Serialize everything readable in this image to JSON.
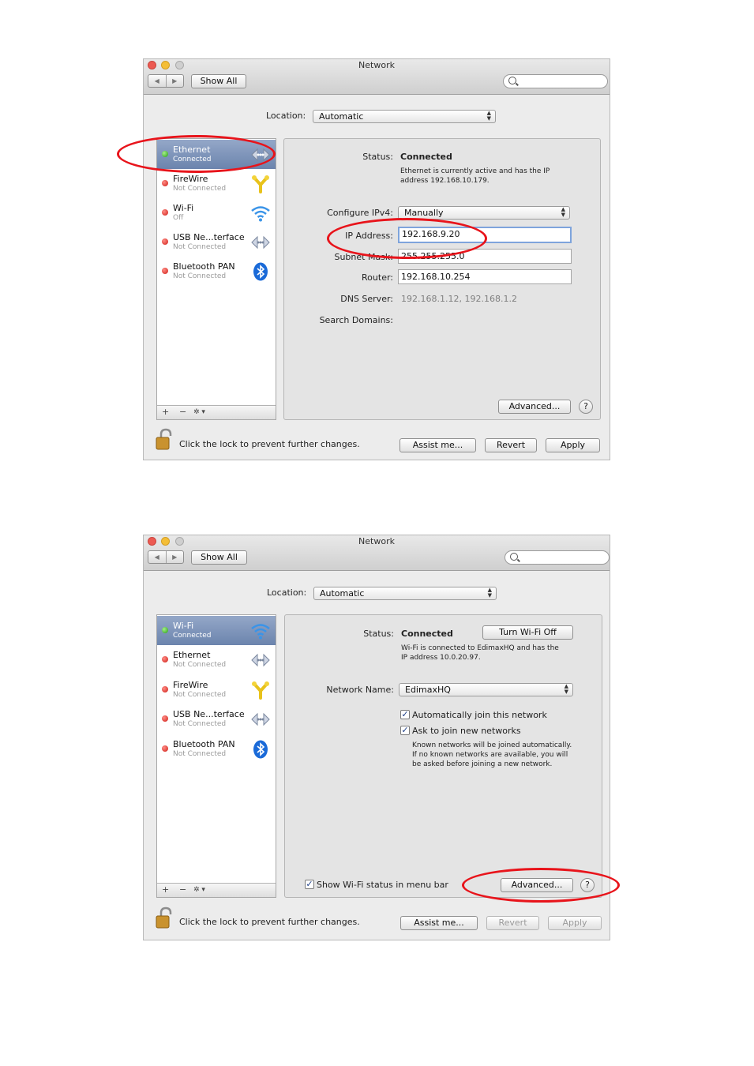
{
  "colors": {
    "annotation_red": "#e8141b",
    "selected_row": "#7f95bb",
    "status_red": "#d8241d",
    "status_green": "#35b01d"
  },
  "icons": {
    "ethernet": "ethernet-arrows-icon",
    "firewire": "firewire-icon",
    "wifi": "wifi-signal-icon",
    "usb": "usb-arrows-icon",
    "bluetooth": "bluetooth-icon",
    "lock": "padlock-icon"
  },
  "window1": {
    "title": "Network",
    "show_all": "Show All",
    "search_placeholder": "",
    "location_label": "Location:",
    "location_value": "Automatic",
    "services": [
      {
        "name": "Ethernet",
        "status": "Connected"
      },
      {
        "name": "FireWire",
        "status": "Not Connected"
      },
      {
        "name": "Wi-Fi",
        "status": "Off"
      },
      {
        "name": "USB Ne...terface",
        "status": "Not Connected"
      },
      {
        "name": "Bluetooth PAN",
        "status": "Not Connected"
      }
    ],
    "sidebar_controls": {
      "add": "+",
      "remove": "−",
      "gear": "✲ ▾"
    },
    "status_label": "Status:",
    "status_value": "Connected",
    "status_desc_1": "Ethernet is currently active and has the IP",
    "status_desc_2": "address 192.168.10.179.",
    "configure_label": "Configure IPv4:",
    "configure_value": "Manually",
    "ip_label": "IP Address:",
    "ip_value": "192.168.9.20",
    "subnet_label": "Subnet Mask:",
    "subnet_value": "255.255.255.0",
    "router_label": "Router:",
    "router_value": "192.168.10.254",
    "dns_label": "DNS Server:",
    "dns_value": "192.168.1.12, 192.168.1.2",
    "search_domains_label": "Search Domains:",
    "advanced": "Advanced...",
    "help": "?",
    "lock_text": "Click the lock to prevent further changes.",
    "assist": "Assist me...",
    "revert": "Revert",
    "apply": "Apply"
  },
  "window2": {
    "title": "Network",
    "show_all": "Show All",
    "search_placeholder": "",
    "location_label": "Location:",
    "location_value": "Automatic",
    "services": [
      {
        "name": "Wi-Fi",
        "status": "Connected"
      },
      {
        "name": "Ethernet",
        "status": "Not Connected"
      },
      {
        "name": "FireWire",
        "status": "Not Connected"
      },
      {
        "name": "USB Ne...terface",
        "status": "Not Connected"
      },
      {
        "name": "Bluetooth PAN",
        "status": "Not Connected"
      }
    ],
    "sidebar_controls": {
      "add": "+",
      "remove": "−",
      "gear": "✲ ▾"
    },
    "status_label": "Status:",
    "status_value": "Connected",
    "turn_off": "Turn Wi-Fi Off",
    "status_desc_1": "Wi-Fi is connected to EdimaxHQ and has the",
    "status_desc_2": "IP address 10.0.20.97.",
    "network_name_label": "Network Name:",
    "network_name_value": "EdimaxHQ",
    "auto_join": "Automatically join this network",
    "ask_join": "Ask to join new networks",
    "info_1": "Known networks will be joined automatically.",
    "info_2": "If no known networks are available, you will",
    "info_3": "be asked before joining a new network.",
    "show_status": "Show Wi-Fi status in menu bar",
    "advanced": "Advanced...",
    "help": "?",
    "lock_text": "Click the lock to prevent further changes.",
    "assist": "Assist me...",
    "revert": "Revert",
    "apply": "Apply"
  }
}
